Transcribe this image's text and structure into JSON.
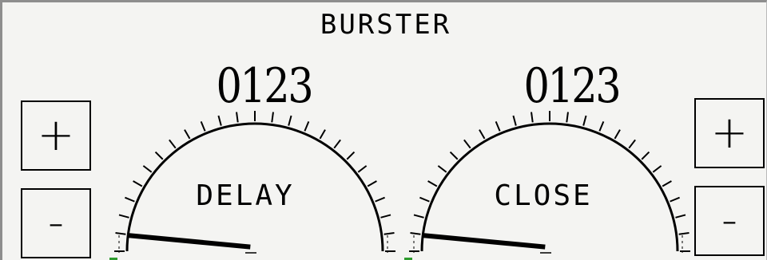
{
  "panel": {
    "title": "BURSTER"
  },
  "gauges": [
    {
      "id": "delay",
      "label": "DELAY",
      "readout": "0123",
      "needle_fraction": 0.03
    },
    {
      "id": "close",
      "label": "CLOSE",
      "readout": "0123",
      "needle_fraction": 0.03
    }
  ],
  "controls": {
    "left": {
      "plus_label": "+",
      "minus_label": "-"
    },
    "right": {
      "plus_label": "+",
      "minus_label": "-"
    }
  },
  "colors": {
    "ink": "#000000",
    "background": "#f4f4f2",
    "indicator": "#2e9b2e"
  }
}
